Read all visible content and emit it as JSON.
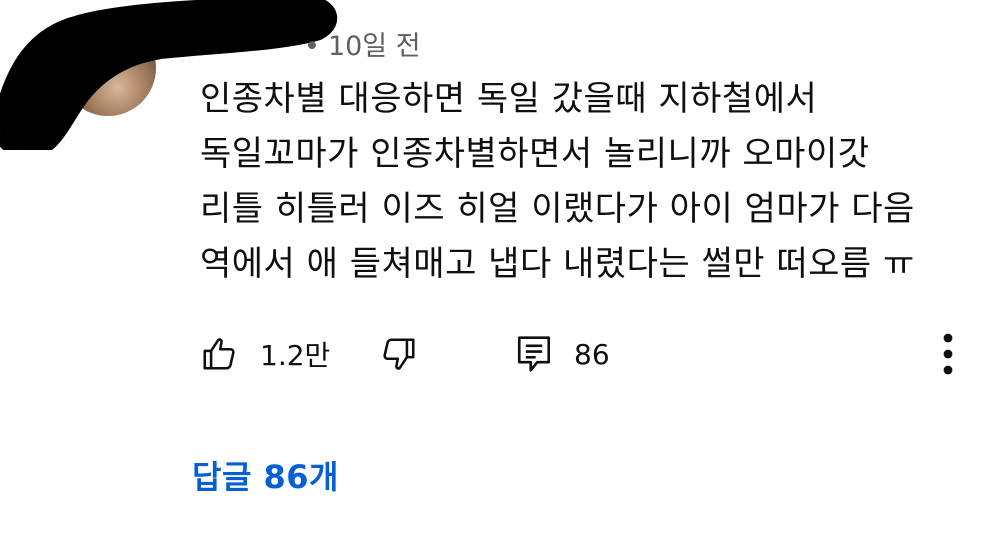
{
  "comment": {
    "author_avatar_icon": "avatar-image",
    "timestamp": "10일 전",
    "meta_separator": "•",
    "text_lines": [
      "인종차별 대응하면 독일 갔을때 지하철에서",
      "독일꼬마가 인종차별하면서 놀리니까 오마이갓",
      "리틀 히틀러 이즈 히얼 이랬다가 아이 엄마가 다음",
      "역에서 애 들쳐매고 냅다 내렸다는 썰만 떠오름 ㅠ"
    ]
  },
  "actions": {
    "like_icon": "thumbs-up-icon",
    "like_count": "1.2만",
    "dislike_icon": "thumbs-down-icon",
    "reply_icon": "reply-comment-icon",
    "reply_count": "86",
    "more_icon": "more-vertical-icon"
  },
  "replies": {
    "label": "답글 86개"
  },
  "colors": {
    "text": "#0f0f0f",
    "meta": "#606060",
    "link": "#065fd4"
  }
}
